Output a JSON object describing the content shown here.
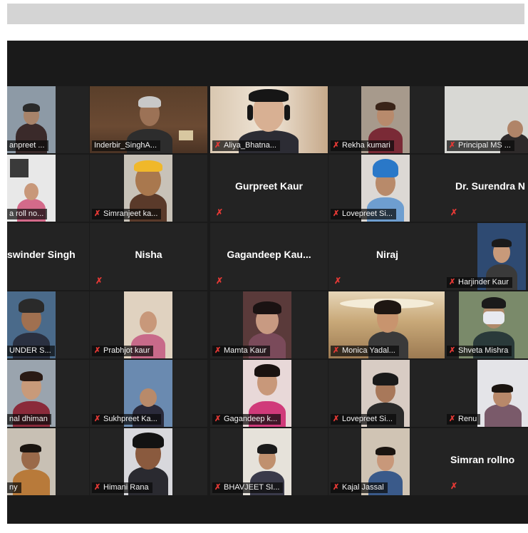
{
  "window": {
    "top_bar": ""
  },
  "colors": {
    "active_speaker": "#c9d42a",
    "muted_mic": "#e53935",
    "tile_bg": "#232323"
  },
  "icons": {
    "muted": "✗"
  },
  "participants": [
    {
      "name": "anpreet ..."
    },
    {
      "name": "Inderbir_SinghA..."
    },
    {
      "name": "Aliya_Bhatna..."
    },
    {
      "name": "Rekha kumari"
    },
    {
      "name": "Principal MS ..."
    },
    {
      "name": "a roll no..."
    },
    {
      "name": "Simranjeet ka..."
    },
    {
      "name": "Gurpreet Kaur"
    },
    {
      "name": "Lovepreet Si..."
    },
    {
      "name": "Dr. Surendra N"
    },
    {
      "name": "swinder Singh"
    },
    {
      "name": "Nisha"
    },
    {
      "name": "Gagandeep  Kau..."
    },
    {
      "name": "Niraj"
    },
    {
      "name": "Harjinder Kaur"
    },
    {
      "name": "UNDER S..."
    },
    {
      "name": "Prabhjot kaur"
    },
    {
      "name": "Mamta Kaur"
    },
    {
      "name": "Monica Yadal..."
    },
    {
      "name": "Shveta Mishra"
    },
    {
      "name": "nal dhiman"
    },
    {
      "name": "Sukhpreet Ka..."
    },
    {
      "name": "Gagandeep k..."
    },
    {
      "name": "Lovepreet Si..."
    },
    {
      "name": "Renu"
    },
    {
      "name": "ny"
    },
    {
      "name": "Himani Rana"
    },
    {
      "name": "BHAVJEET SI..."
    },
    {
      "name": "Kajal Jassal"
    },
    {
      "name": "Simran rollno"
    }
  ]
}
